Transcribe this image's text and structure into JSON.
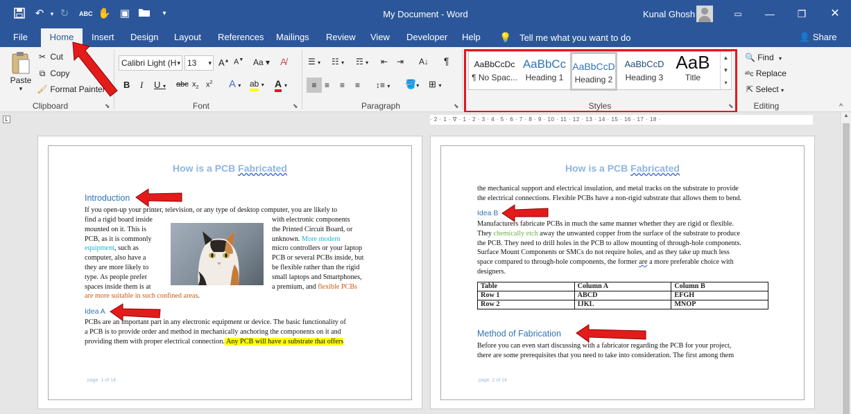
{
  "window": {
    "title": "My Document  -  Word",
    "user": "Kunal Ghosh"
  },
  "menu": {
    "tabs": [
      "File",
      "Home",
      "Insert",
      "Design",
      "Layout",
      "References",
      "Mailings",
      "Review",
      "View",
      "Developer",
      "Help"
    ],
    "tell_me": "Tell me what you want to do",
    "share": "Share"
  },
  "ribbon": {
    "clipboard": {
      "label": "Clipboard",
      "paste": "Paste",
      "cut": "Cut",
      "copy": "Copy",
      "format_painter": "Format Painter"
    },
    "font": {
      "label": "Font",
      "name": "Calibri Light (H",
      "size": "13"
    },
    "paragraph": {
      "label": "Paragraph"
    },
    "styles": {
      "label": "Styles",
      "items": [
        {
          "preview": "AaBbCcDc",
          "name": "¶ No Spac..."
        },
        {
          "preview": "AaBbCc",
          "name": "Heading 1"
        },
        {
          "preview": "AaBbCcD",
          "name": "Heading 2"
        },
        {
          "preview": "AaBbCcD",
          "name": "Heading 3"
        },
        {
          "preview": "AaB",
          "name": "Title"
        }
      ]
    },
    "editing": {
      "label": "Editing",
      "find": "Find",
      "replace": "Replace",
      "select": "Select"
    }
  },
  "ruler": {
    "text": "· 2 · 1 · ∇ · 1 · 2 · 3 · 4 · 5 · 6 · 7 · 8 · 9 · 10 · 11 · 12 · 13 · 14 · 15 · 16 · 17 · 18 ·"
  },
  "page1": {
    "title_a": "How is a PCB ",
    "title_b": "Fabricated",
    "heading_intro": "Introduction",
    "p1_full": "If you open-up your printer, television, or any type of desktop computer, you are likely to",
    "left_col": [
      "find a rigid board inside",
      "mounted on it. This is",
      "PCB, as it is commonly"
    ],
    "left_eq": "equipment",
    "left_eq_rest": ", such as",
    "left_col2": [
      "computer, also have a",
      "they are more likely to",
      "type. As people prefer",
      "spaces inside them is at"
    ],
    "left_last": "are more suitable in such confined areas",
    "left_last_end": ".",
    "right_col": [
      "with electronic components",
      "the Printed Circuit Board, or"
    ],
    "right_unknown": "unknown. ",
    "right_more": "More modern",
    "right_col2": [
      "micro controllers or your laptop",
      "PCB or several PCBs inside, but",
      "be flexible rather than the rigid",
      "small laptops and Smartphones,"
    ],
    "right_prem": "a premium, and ",
    "right_flex": "flexible PCBs",
    "heading_idea_a": "Idea A",
    "ideaA_lines": [
      "PCBs are an important part in any electronic equipment or device. The basic functionality of",
      "a PCB is to provide order and method in mechanically anchoring the components on it and"
    ],
    "ideaA_last": "providing them with proper electrical connection.",
    "ideaA_hl": " Any PCB will have a substrate that offers",
    "footer": "page. 1 of 14"
  },
  "page2": {
    "title_a": "How is a PCB ",
    "title_b": "Fabricated",
    "p0": [
      "the mechanical support and electrical insulation, and metal tracks on the substrate to provide",
      "the electrical connections. Flexible PCBs have a non-rigid substrate that allows them to bend."
    ],
    "heading_idea_b": "Idea B",
    "ideaB_l1": "Manufacturers fabricate PCBs in much the same manner whether they are rigid or flexible.",
    "ideaB_they": "They ",
    "ideaB_chem": "chemically etch",
    "ideaB_rest": " away the unwanted copper from the surface of the substrate to produce",
    "ideaB_lines": [
      "the PCB. They need to drill holes in the PCB to allow mounting of through-hole components.",
      "Surface Mount Components or SMCs do not require holes, and as they take up much less"
    ],
    "ideaB_l5a": "space compared to through-hole components, the former ",
    "ideaB_are": "are",
    "ideaB_l5b": " a more preferable choice with",
    "ideaB_l6": "designers.",
    "table": {
      "header": [
        "Table",
        "Column A",
        "Column B"
      ],
      "rows": [
        [
          "Row 1",
          "ABCD",
          "EFGH"
        ],
        [
          "Row 2",
          "IJKL",
          "MNOP"
        ]
      ]
    },
    "heading_method": "Method of Fabrication",
    "method_lines": [
      "Before you can even start discussing with a fabricator regarding the PCB for your project,",
      "there are some prerequisites that you need to take into consideration. The first among them"
    ],
    "footer": "page. 2 of 14"
  },
  "colors": {
    "accent": "#2b579a",
    "highlight_box": "#e8141c",
    "arrow": "#e41b1b",
    "heading": "#2e74b5"
  }
}
